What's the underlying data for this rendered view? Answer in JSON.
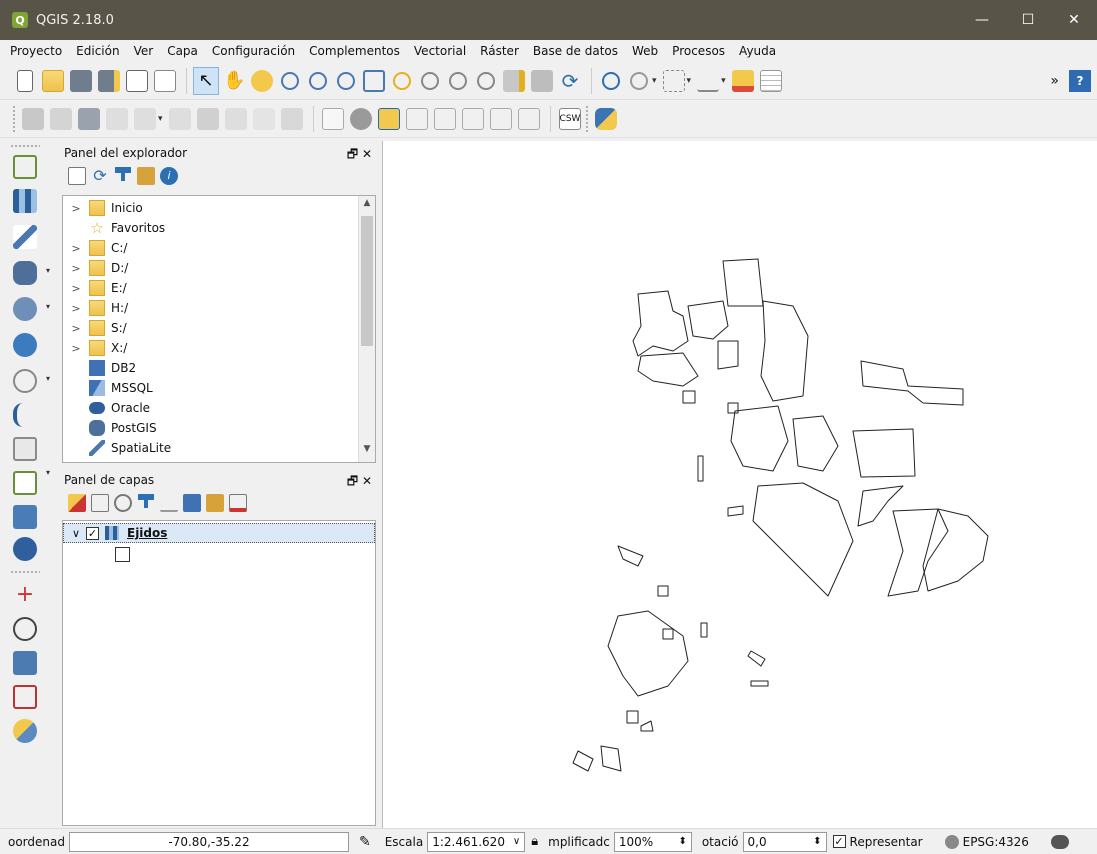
{
  "window": {
    "title": "QGIS 2.18.0",
    "minimize": "—",
    "maximize": "☐",
    "close": "✕"
  },
  "menu": [
    "Proyecto",
    "Edición",
    "Ver",
    "Capa",
    "Configuración",
    "Complementos",
    "Vectorial",
    "Ráster",
    "Base de datos",
    "Web",
    "Procesos",
    "Ayuda"
  ],
  "toolbar_overflow": "»",
  "toolbar_help": "?",
  "csw_label": "CSW",
  "browser_panel": {
    "title": "Panel del explorador",
    "controls": "🗗 ✕",
    "items": [
      "Inicio",
      "Favoritos",
      "C:/",
      "D:/",
      "E:/",
      "H:/",
      "S:/",
      "X:/",
      "DB2",
      "MSSQL",
      "Oracle",
      "PostGIS",
      "SpatiaLite"
    ]
  },
  "layers_panel": {
    "title": "Panel de capas",
    "controls": "🗗 ✕",
    "layer_name": "Ejidos"
  },
  "status": {
    "coord_label": "oordenad",
    "coord_value": "-70.80,-35.22",
    "scale_label": "Escala",
    "scale_value": "1:2.461.620",
    "magnifier_label": "mplificadc",
    "magnifier_value": "100%",
    "rotation_label": "otació",
    "rotation_value": "0,0",
    "render_label": "Representar",
    "crs": "EPSG:4326"
  },
  "colors": {
    "titlebar": "#585448",
    "selection": "#dbe8f6",
    "canvas": "#ffffff"
  }
}
